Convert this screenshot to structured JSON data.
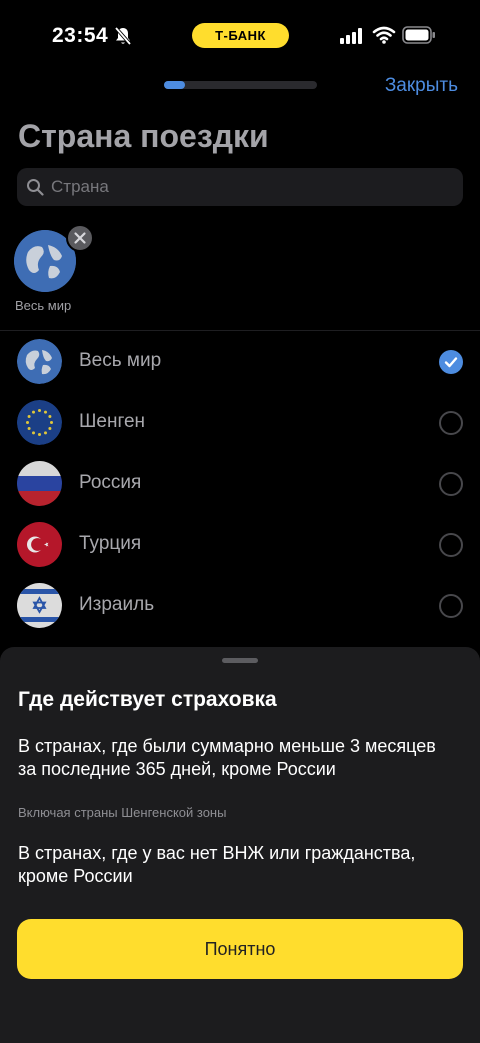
{
  "status_bar": {
    "time": "23:54",
    "bank_label": "Т-БАНК",
    "bank_color": "#ffdd2d"
  },
  "nav": {
    "progress": 0.14,
    "close_label": "Закрыть",
    "accent_color": "#4d8ce0"
  },
  "page": {
    "title": "Страна поездки",
    "search": {
      "placeholder": "Страна",
      "icon": "search-icon"
    },
    "selected_chips": [
      {
        "label": "Весь мир",
        "icon": "globe-icon"
      }
    ],
    "countries": [
      {
        "name": "Весь мир",
        "icon": "globe-icon",
        "selected": true
      },
      {
        "name": "Шенген",
        "icon": "eu-flag-icon",
        "selected": false
      },
      {
        "name": "Россия",
        "icon": "russia-flag-icon",
        "selected": false
      },
      {
        "name": "Турция",
        "icon": "turkey-flag-icon",
        "selected": false
      },
      {
        "name": "Израиль",
        "icon": "israel-flag-icon",
        "selected": false
      }
    ]
  },
  "sheet": {
    "title": "Где действует страховка",
    "paragraph1": "В странах, где были суммарно меньше 3 месяцев за последние 365 дней, кроме России",
    "note": "Включая страны Шенгенской зоны",
    "paragraph2": "В странах, где у вас нет ВНЖ или гражданства, кроме России",
    "button_label": "Понятно"
  }
}
